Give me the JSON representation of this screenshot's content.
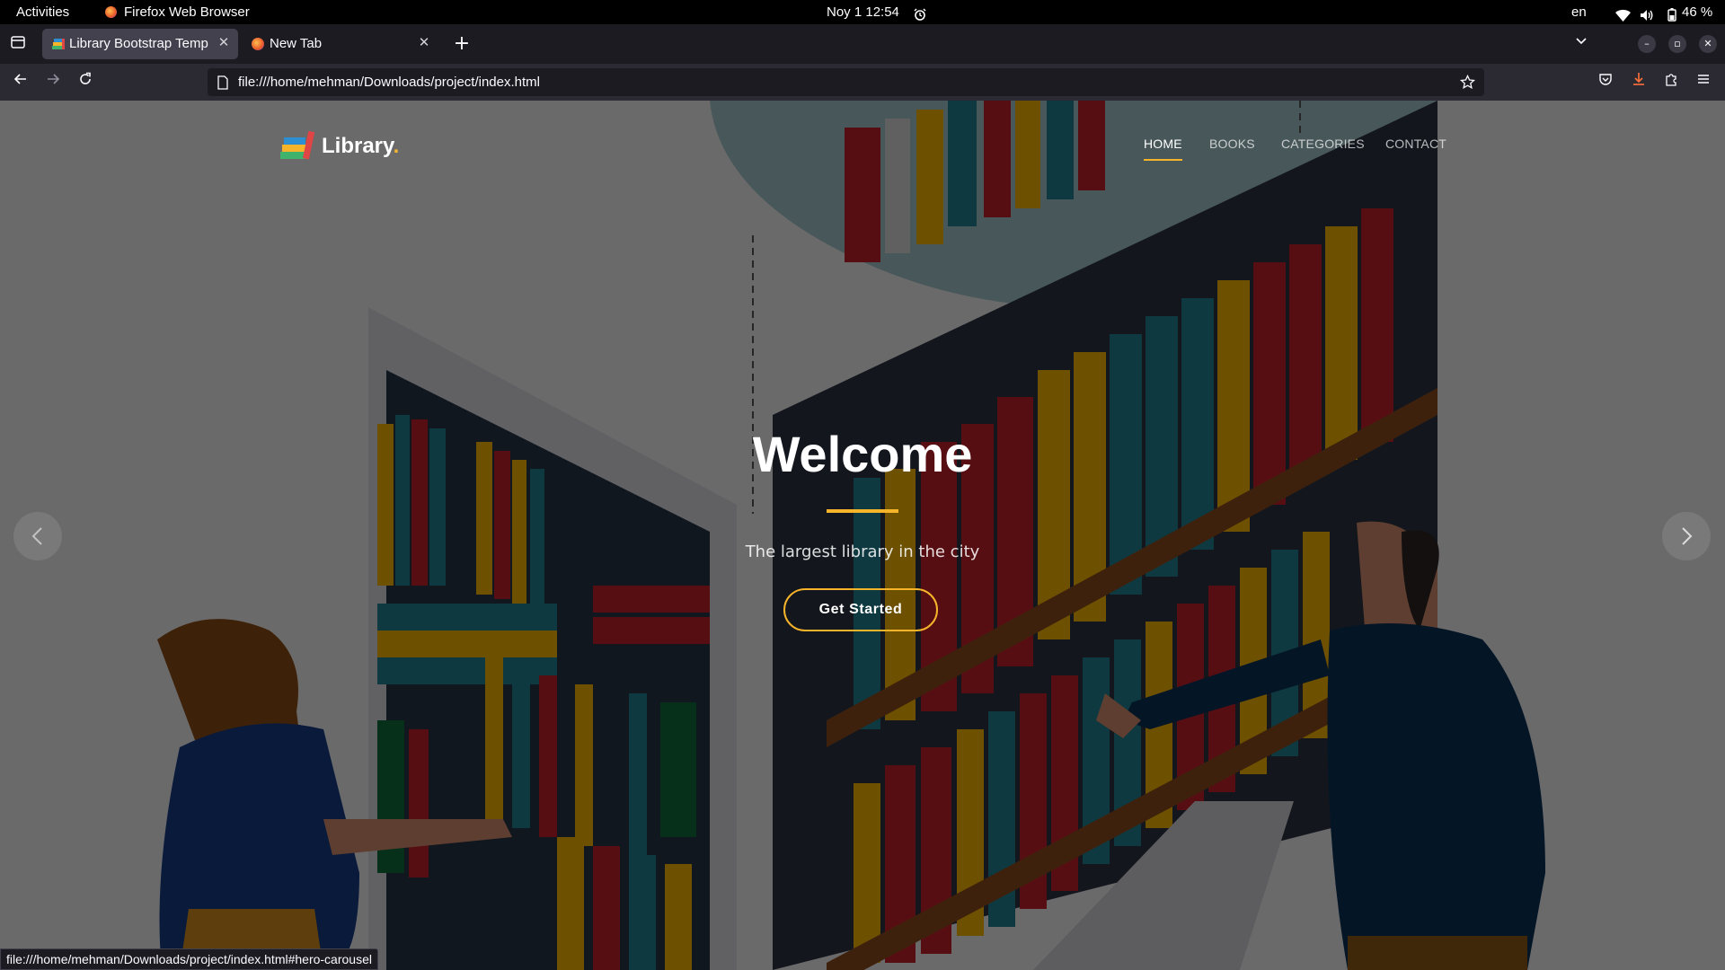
{
  "system_bar": {
    "activities": "Activities",
    "app_name": "Firefox Web Browser",
    "clock": "Noy 1  12:54",
    "language": "en",
    "battery": "46 %"
  },
  "browser": {
    "tabs": [
      {
        "title": "Library Bootstrap Templ",
        "active": true
      },
      {
        "title": "New Tab",
        "active": false
      }
    ],
    "url": "file:///home/mehman/Downloads/project/index.html",
    "status_link": "file:///home/mehman/Downloads/project/index.html#hero-carousel"
  },
  "site": {
    "logo_text": "Library",
    "logo_dot": ".",
    "nav": [
      "HOME",
      "BOOKS",
      "CATEGORIES",
      "CONTACT"
    ],
    "active_nav": "HOME"
  },
  "hero": {
    "title": "Welcome",
    "subtitle": "The largest library in the city",
    "cta": "Get Started"
  },
  "colors": {
    "accent": "#f5b42a",
    "overlay": "rgba(0,0,0,0.55)",
    "browser_bg": "#1c1b22",
    "toolbar_bg": "#2b2a33"
  },
  "icons": {
    "prev": "chevron-left-icon",
    "next": "chevron-right-icon"
  }
}
